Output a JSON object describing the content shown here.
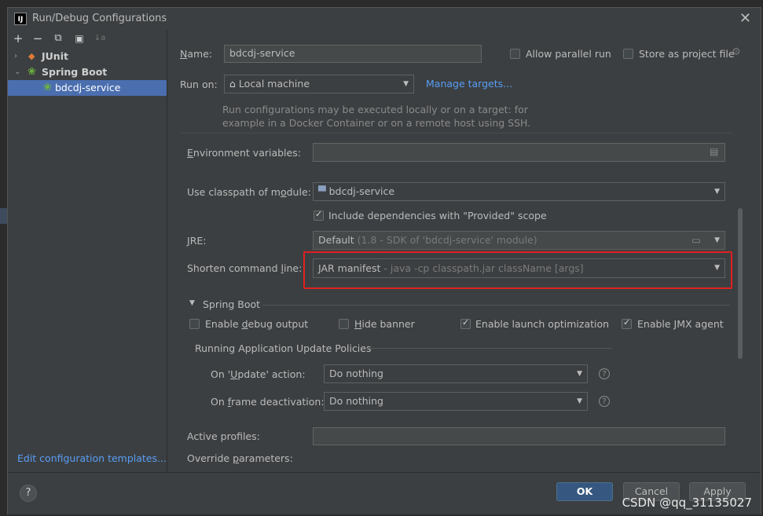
{
  "window": {
    "title": "Run/Debug Configurations"
  },
  "toolbar": {
    "add": "+",
    "remove": "−",
    "copy": "⧉",
    "folder": "▣",
    "sort": "↓a"
  },
  "tree": {
    "junit": "JUnit",
    "spring_boot": "Spring Boot",
    "bdcdj_service": "bdcdj-service"
  },
  "edit_templates": "Edit configuration templates...",
  "name": {
    "label": "Name:",
    "value": "bdcdj-service"
  },
  "allow_parallel": {
    "label": "Allow parallel run",
    "checked": false
  },
  "store_project": {
    "label": "Store as project file",
    "checked": false
  },
  "run_on": {
    "label": "Run on:",
    "value": "Local machine",
    "manage": "Manage targets...",
    "hint_line1": "Run configurations may be executed locally or on a target: for",
    "hint_line2": "example in a Docker Container or on a remote host using SSH."
  },
  "env": {
    "label": "Environment variables:",
    "value": ""
  },
  "classpath": {
    "label": "Use classpath of module:",
    "value": "bdcdj-service"
  },
  "include_deps": {
    "label": "Include dependencies with \"Provided\" scope",
    "checked": true
  },
  "jre": {
    "label": "JRE:",
    "value": "Default",
    "detail": "(1.8 - SDK of 'bdcdj-service' module)"
  },
  "shorten": {
    "label": "Shorten command line:",
    "value": "JAR manifest",
    "detail": "- java -cp classpath.jar className [args]"
  },
  "spring_boot": {
    "section": "Spring Boot",
    "debug_output": {
      "label": "Enable debug output",
      "checked": false
    },
    "hide_banner": {
      "label": "Hide banner",
      "checked": false
    },
    "launch_opt": {
      "label": "Enable launch optimization",
      "checked": true
    },
    "jmx": {
      "label": "Enable JMX agent",
      "checked": true
    },
    "policies_title": "Running Application Update Policies",
    "on_update": {
      "label": "On 'Update' action:",
      "value": "Do nothing"
    },
    "on_frame": {
      "label": "On frame deactivation:",
      "value": "Do nothing"
    }
  },
  "active_profiles": {
    "label": "Active profiles:",
    "value": ""
  },
  "override_params": {
    "label": "Override parameters:"
  },
  "buttons": {
    "ok": "OK",
    "cancel": "Cancel",
    "apply": "Apply",
    "help": "?"
  },
  "watermark": "CSDN @qq_31135027",
  "colors": {
    "accent": "#4b6eaf",
    "link": "#589df6",
    "highlight": "#e02020"
  }
}
